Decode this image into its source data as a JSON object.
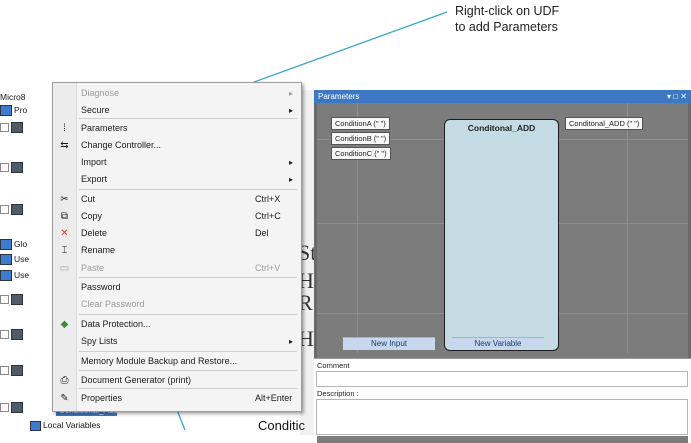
{
  "callouts": {
    "top": "Right-click on UDF\nto add Parameters"
  },
  "tree": {
    "root": "Micro8",
    "items": [
      "Pro",
      "Glo",
      "Use",
      "Use"
    ],
    "local_variables": "Local Variables",
    "selected_row": "Conditional_Add"
  },
  "context_menu": {
    "items": [
      {
        "label": "Diagnose",
        "disabled": true,
        "submenu": true
      },
      {
        "label": "Secure",
        "submenu": true
      },
      {
        "label": "Parameters",
        "icon": "parameters-icon"
      },
      {
        "label": "Change Controller...",
        "icon": "change-controller-icon"
      },
      {
        "label": "Import",
        "submenu": true
      },
      {
        "label": "Export",
        "submenu": true
      },
      {
        "label": "Cut",
        "shortcut": "Ctrl+X",
        "icon": "cut-icon"
      },
      {
        "label": "Copy",
        "shortcut": "Ctrl+C",
        "icon": "copy-icon"
      },
      {
        "label": "Delete",
        "shortcut": "Del",
        "icon": "delete-icon"
      },
      {
        "label": "Rename",
        "icon": "rename-icon"
      },
      {
        "label": "Paste",
        "shortcut": "Ctrl+V",
        "disabled": true,
        "icon": "paste-icon"
      },
      {
        "label": "Password"
      },
      {
        "label": "Clear Password",
        "disabled": true
      },
      {
        "label": "Data Protection...",
        "icon": "data-protection-icon"
      },
      {
        "label": "Spy Lists",
        "submenu": true
      },
      {
        "label": "Memory Module Backup and Restore..."
      },
      {
        "label": "Document Generator (print)",
        "icon": "printer-icon"
      },
      {
        "label": "Properties",
        "shortcut": "Alt+Enter",
        "icon": "properties-icon"
      }
    ]
  },
  "parameters_window": {
    "title": "Parameters",
    "title_buttons": "▾ □ ✕",
    "block_name": "Conditonal_ADD",
    "inputs": [
      "ConditionA (\"  \")",
      "ConditionB (\"  \")",
      "ConditionC (\"  \")"
    ],
    "output": "Conditonal_ADD (\"  \")",
    "new_input": "New Input",
    "new_variable": "New Variable",
    "comment_label": "Comment",
    "description_label": "Description :"
  },
  "background": {
    "conditional_text": "Conditic",
    "big_letters": [
      "St",
      "H",
      "R",
      "H"
    ]
  },
  "colors": {
    "accent": "#3c78c4",
    "block_fill": "#c4dbe4",
    "callout_line": "#3aa6c9"
  }
}
